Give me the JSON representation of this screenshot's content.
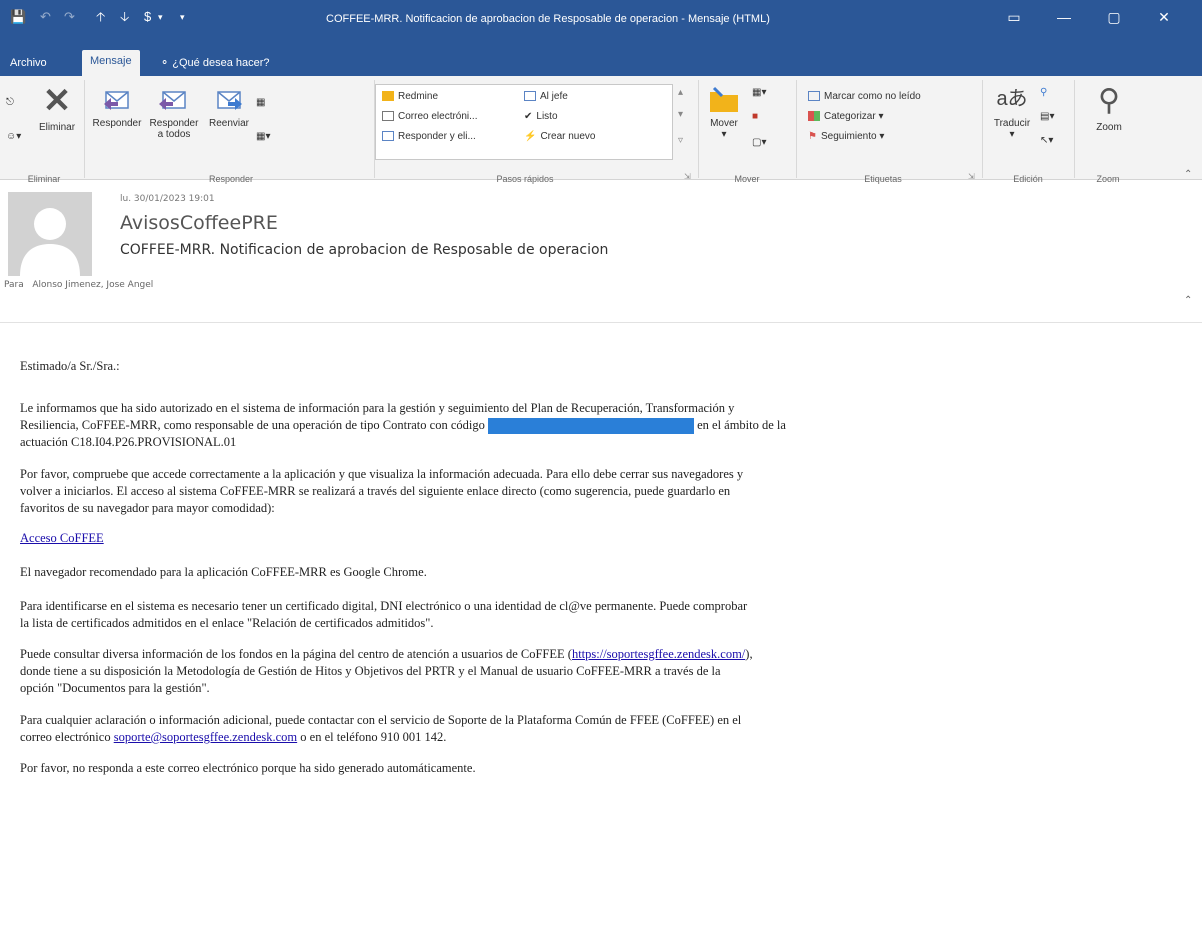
{
  "window": {
    "title": "COFFEE-MRR. Notificacion de aprobacion de Resposable de operacion - Mensaje (HTML)",
    "controls": [
      "▭",
      "—",
      "▢",
      "✕"
    ]
  },
  "tabs": {
    "archivo": "Archivo",
    "mensaje": "Mensaje",
    "search": "¿Qué desea hacer?"
  },
  "ribbon": {
    "eliminar": {
      "delete": "Eliminar",
      "group": "Eliminar"
    },
    "responder": {
      "reply": "Responder",
      "reply_all_line1": "Responder",
      "reply_all_line2": "a todos",
      "forward": "Reenviar",
      "group": "Responder"
    },
    "pasos": {
      "items": [
        "Redmine",
        "Correo electróni...",
        "Responder y eli...",
        "Al jefe",
        "Listo",
        "Crear nuevo"
      ],
      "group": "Pasos rápidos"
    },
    "mover": {
      "move": "Mover",
      "group": "Mover"
    },
    "etiquetas": {
      "unread": "Marcar como no leído",
      "categorize": "Categorizar",
      "followup": "Seguimiento",
      "group": "Etiquetas"
    },
    "edicion": {
      "translate": "Traducir",
      "group": "Edición"
    },
    "zoom": {
      "zoom": "Zoom",
      "group": "Zoom"
    }
  },
  "message": {
    "date": "lu. 30/01/2023 19:01",
    "sender": "AvisosCoffeePRE",
    "subject": "COFFEE-MRR. Notificacion de aprobacion de Resposable de operacion",
    "to_label": "Para",
    "to": "Alonso Jimenez, Jose Angel"
  },
  "body": {
    "greeting": "Estimado/a Sr./Sra.:",
    "p1_a": "Le informamos que ha sido autorizado en el sistema de información para la gestión y seguimiento del Plan de Recuperación, Transformación y",
    "p1_b": "Resiliencia, CoFFEE-MRR, como responsable de una operación de tipo Contrato con código",
    "p1_c": "en el ámbito de la",
    "p1_d": "actuación C18.I04.P26.PROVISIONAL.01",
    "p2_a": "Por favor, compruebe que accede correctamente a la aplicación y que visualiza la información adecuada. Para ello debe cerrar sus navegadores y",
    "p2_b": "volver a iniciarlos. El acceso al sistema CoFFEE-MRR se realizará a través del siguiente enlace directo (como sugerencia, puede guardarlo en",
    "p2_c": "favoritos de su navegador para mayor comodidad):",
    "link_access": "Acceso CoFFEE",
    "p3": "El navegador recomendado para la aplicación CoFFEE-MRR es Google Chrome.",
    "p4_a": "Para identificarse en el sistema es necesario tener un certificado digital, DNI electrónico o una identidad de cl@ve permanente. Puede comprobar",
    "p4_b": "la lista de certificados admitidos en el enlace \"Relación de certificados admitidos\".",
    "p5_a1": "Puede consultar diversa información de los fondos en la página del centro de atención a usuarios de CoFFEE (",
    "p5_link": "https://soportesgffee.zendesk.com/",
    "p5_a2": "),",
    "p5_b": "donde tiene a su disposición la Metodología de Gestión de Hitos y Objetivos del PRTR y el Manual de usuario CoFFEE-MRR a través de la",
    "p5_c": "opción \"Documentos para la gestión\".",
    "p6_a": "Para cualquier aclaración o información adicional, puede contactar con el servicio de Soporte de la Plataforma Común de FFEE (CoFFEE) en el",
    "p6_b1": "correo electrónico",
    "p6_link": "soporte@soportesgffee.zendesk.com",
    "p6_b2": "o en el teléfono 910 001 142.",
    "p7": "Por favor, no responda a este correo electrónico porque ha sido generado automáticamente."
  },
  "colors": {
    "titlebar": "#2b5797",
    "ribbon": "#f3f3f3",
    "link": "#1a0dab",
    "redaction": "#2a7fd8"
  }
}
